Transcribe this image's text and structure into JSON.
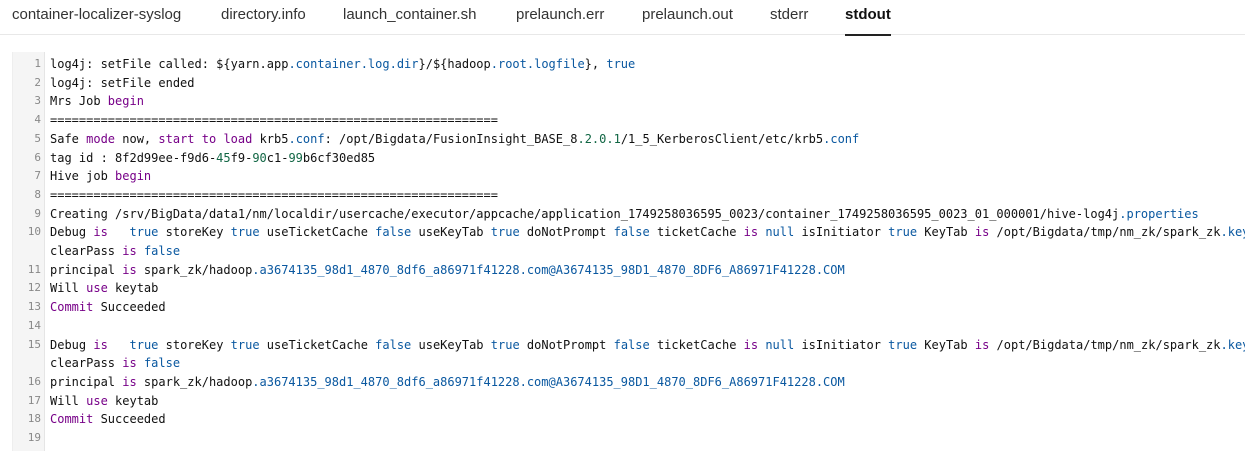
{
  "tabs": [
    {
      "label": "container-localizer-syslog",
      "active": false
    },
    {
      "label": "directory.info",
      "active": false
    },
    {
      "label": "launch_container.sh",
      "active": false
    },
    {
      "label": "prelaunch.err",
      "active": false
    },
    {
      "label": "prelaunch.out",
      "active": false
    },
    {
      "label": "stderr",
      "active": false
    },
    {
      "label": "stdout",
      "active": true
    }
  ],
  "lines": [
    {
      "num": "1",
      "segs": [
        [
          "log4j: setFile called: ${",
          "t"
        ],
        [
          "yarn",
          "t"
        ],
        [
          ".app",
          "t"
        ],
        [
          ".container",
          "p"
        ],
        [
          ".log",
          "p"
        ],
        [
          ".dir",
          "p"
        ],
        [
          "}/${hadoop",
          "t"
        ],
        [
          ".root",
          "p"
        ],
        [
          ".logfile",
          "p"
        ],
        [
          "}, ",
          "t"
        ],
        [
          "true",
          "p"
        ]
      ]
    },
    {
      "num": "2",
      "segs": [
        [
          "log4j: setFile ended",
          "t"
        ]
      ]
    },
    {
      "num": "3",
      "segs": [
        [
          "Mrs Job ",
          "t"
        ],
        [
          "begin",
          "k"
        ]
      ]
    },
    {
      "num": "4",
      "segs": [
        [
          "==============================================================",
          "t"
        ]
      ]
    },
    {
      "num": "5",
      "segs": [
        [
          "Safe ",
          "t"
        ],
        [
          "mode",
          "k"
        ],
        [
          " now, ",
          "t"
        ],
        [
          "start",
          "k"
        ],
        [
          " ",
          "t"
        ],
        [
          "to",
          "k"
        ],
        [
          " ",
          "t"
        ],
        [
          "load",
          "k"
        ],
        [
          " krb5",
          "t"
        ],
        [
          ".conf",
          "p"
        ],
        [
          ": /opt/Bigdata/FusionInsight_BASE_8",
          "t"
        ],
        [
          ".2",
          "n"
        ],
        [
          ".0",
          "n"
        ],
        [
          ".1",
          "n"
        ],
        [
          "/1_5_KerberosClient/etc/krb5",
          "t"
        ],
        [
          ".conf",
          "p"
        ]
      ]
    },
    {
      "num": "6",
      "segs": [
        [
          "tag id : 8f2d99ee-f9d6-",
          "t"
        ],
        [
          "45",
          "n"
        ],
        [
          "f9-",
          "t"
        ],
        [
          "90",
          "n"
        ],
        [
          "c1-",
          "t"
        ],
        [
          "99",
          "n"
        ],
        [
          "b6cf30ed85",
          "t"
        ]
      ]
    },
    {
      "num": "7",
      "segs": [
        [
          "Hive job ",
          "t"
        ],
        [
          "begin",
          "k"
        ]
      ]
    },
    {
      "num": "8",
      "segs": [
        [
          "==============================================================",
          "t"
        ]
      ]
    },
    {
      "num": "9",
      "segs": [
        [
          "Creating /srv/BigData/data1/nm/localdir/usercache/executor/appcache/application_1749258036595_0023/container_1749258036595_0023_01_000001/hive-log4j",
          "t"
        ],
        [
          ".properties",
          "p"
        ]
      ]
    },
    {
      "num": "10",
      "segs": [
        [
          "Debug ",
          "t"
        ],
        [
          "is",
          "k"
        ],
        [
          "   ",
          "t"
        ],
        [
          "true",
          "p"
        ],
        [
          " storeKey ",
          "t"
        ],
        [
          "true",
          "p"
        ],
        [
          " useTicketCache ",
          "t"
        ],
        [
          "false",
          "p"
        ],
        [
          " useKeyTab ",
          "t"
        ],
        [
          "true",
          "p"
        ],
        [
          " doNotPrompt ",
          "t"
        ],
        [
          "false",
          "p"
        ],
        [
          " ticketCache ",
          "t"
        ],
        [
          "is",
          "k"
        ],
        [
          " ",
          "t"
        ],
        [
          "null",
          "p"
        ],
        [
          " isInitiator ",
          "t"
        ],
        [
          "true",
          "p"
        ],
        [
          " KeyTab ",
          "t"
        ],
        [
          "is",
          "k"
        ],
        [
          " /opt/Bigdata/tmp/nm_zk/spark_zk",
          "t"
        ],
        [
          ".keytab",
          "p"
        ],
        [
          " r",
          "t"
        ]
      ]
    },
    {
      "num": "",
      "segs": [
        [
          "clearPass ",
          "t"
        ],
        [
          "is",
          "k"
        ],
        [
          " ",
          "t"
        ],
        [
          "false",
          "p"
        ]
      ]
    },
    {
      "num": "11",
      "segs": [
        [
          "principal ",
          "t"
        ],
        [
          "is",
          "k"
        ],
        [
          " spark_zk/hadoop",
          "t"
        ],
        [
          ".a3674135_98d1_4870_8df6_a86971f41228",
          "p"
        ],
        [
          ".com",
          "p"
        ],
        [
          "@A3674135_98D1_4870_8DF6_A86971F41228",
          "p"
        ],
        [
          ".COM",
          "p"
        ]
      ]
    },
    {
      "num": "12",
      "segs": [
        [
          "Will ",
          "t"
        ],
        [
          "use",
          "k"
        ],
        [
          " keytab",
          "t"
        ]
      ]
    },
    {
      "num": "13",
      "segs": [
        [
          "Commit",
          "k"
        ],
        [
          " Succeeded",
          "t"
        ]
      ]
    },
    {
      "num": "14",
      "segs": [
        [
          "",
          "t"
        ]
      ]
    },
    {
      "num": "15",
      "segs": [
        [
          "Debug ",
          "t"
        ],
        [
          "is",
          "k"
        ],
        [
          "   ",
          "t"
        ],
        [
          "true",
          "p"
        ],
        [
          " storeKey ",
          "t"
        ],
        [
          "true",
          "p"
        ],
        [
          " useTicketCache ",
          "t"
        ],
        [
          "false",
          "p"
        ],
        [
          " useKeyTab ",
          "t"
        ],
        [
          "true",
          "p"
        ],
        [
          " doNotPrompt ",
          "t"
        ],
        [
          "false",
          "p"
        ],
        [
          " ticketCache ",
          "t"
        ],
        [
          "is",
          "k"
        ],
        [
          " ",
          "t"
        ],
        [
          "null",
          "p"
        ],
        [
          " isInitiator ",
          "t"
        ],
        [
          "true",
          "p"
        ],
        [
          " KeyTab ",
          "t"
        ],
        [
          "is",
          "k"
        ],
        [
          " /opt/Bigdata/tmp/nm_zk/spark_zk",
          "t"
        ],
        [
          ".keytab",
          "p"
        ],
        [
          " r",
          "t"
        ]
      ]
    },
    {
      "num": "",
      "segs": [
        [
          "clearPass ",
          "t"
        ],
        [
          "is",
          "k"
        ],
        [
          " ",
          "t"
        ],
        [
          "false",
          "p"
        ]
      ]
    },
    {
      "num": "16",
      "segs": [
        [
          "principal ",
          "t"
        ],
        [
          "is",
          "k"
        ],
        [
          " spark_zk/hadoop",
          "t"
        ],
        [
          ".a3674135_98d1_4870_8df6_a86971f41228",
          "p"
        ],
        [
          ".com",
          "p"
        ],
        [
          "@A3674135_98D1_4870_8DF6_A86971F41228",
          "p"
        ],
        [
          ".COM",
          "p"
        ]
      ]
    },
    {
      "num": "17",
      "segs": [
        [
          "Will ",
          "t"
        ],
        [
          "use",
          "k"
        ],
        [
          " keytab",
          "t"
        ]
      ]
    },
    {
      "num": "18",
      "segs": [
        [
          "Commit",
          "k"
        ],
        [
          " Succeeded",
          "t"
        ]
      ]
    },
    {
      "num": "19",
      "segs": [
        [
          "",
          "t"
        ]
      ]
    }
  ]
}
